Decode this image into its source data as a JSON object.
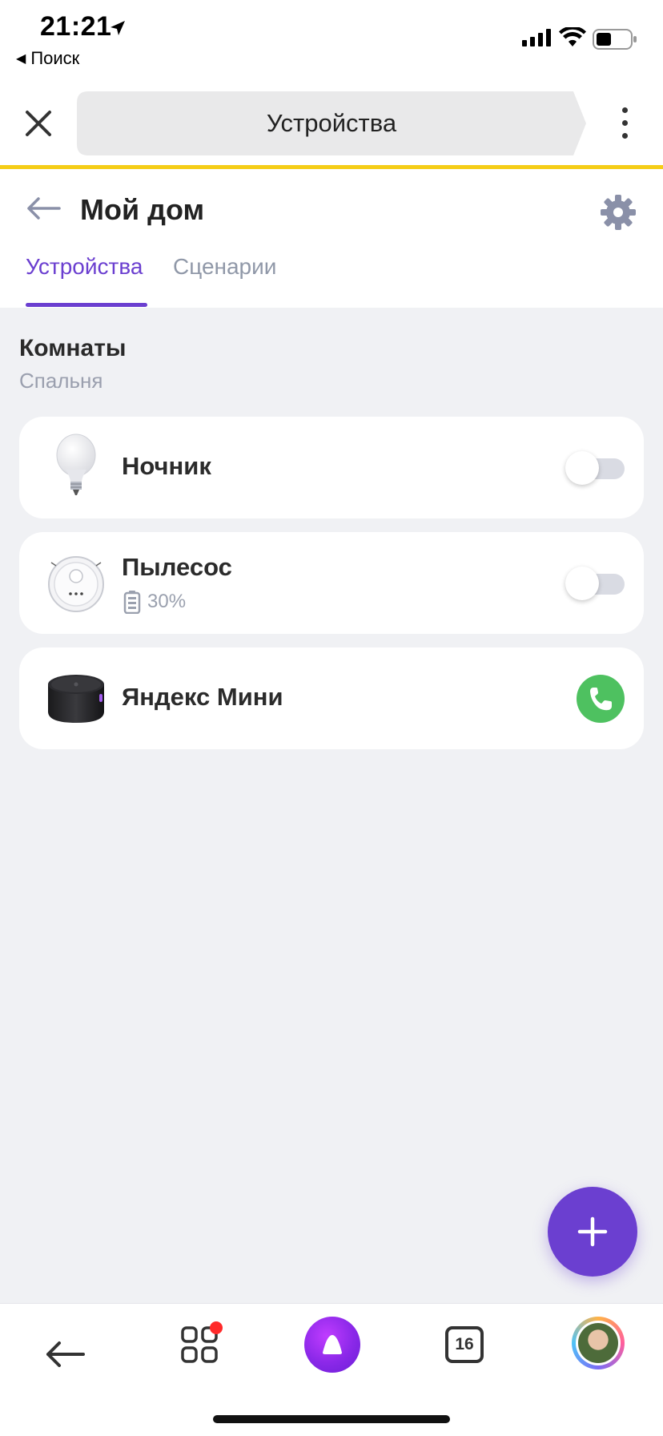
{
  "status_bar": {
    "time": "21:21",
    "back_app": "Поиск"
  },
  "browser": {
    "url_title": "Устройства"
  },
  "header": {
    "title": "Мой дом",
    "tabs": [
      {
        "label": "Устройства",
        "active": true
      },
      {
        "label": "Сценарии",
        "active": false
      }
    ]
  },
  "section": {
    "title": "Комнаты",
    "room": "Спальня"
  },
  "devices": [
    {
      "name": "Ночник",
      "icon": "bulb-icon",
      "toggle_on": false
    },
    {
      "name": "Пылесос",
      "icon": "vacuum-icon",
      "battery": "30%",
      "toggle_on": false
    },
    {
      "name": "Яндекс Мини",
      "icon": "speaker-icon",
      "action": "call"
    }
  ],
  "bottom_nav": {
    "tabs_count": "16"
  },
  "colors": {
    "accent": "#6b3fd0",
    "browser_line": "#f5cd17",
    "call_green": "#4ec160",
    "notification": "#ff2a2a"
  }
}
